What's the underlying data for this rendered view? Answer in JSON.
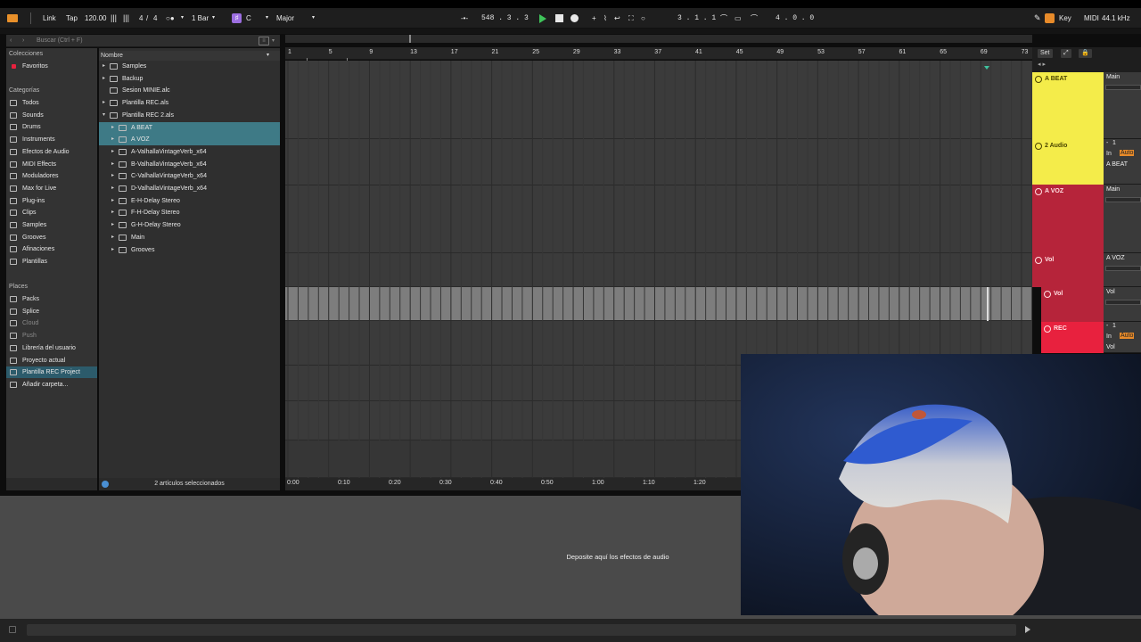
{
  "toolbar": {
    "link": "Link",
    "tap": "Tap",
    "tempo": "120.00",
    "time_sig_num": "4",
    "time_sig_sep": "/",
    "time_sig_den": "4",
    "quantize": "1 Bar",
    "scale_root": "C",
    "scale_mode": "Major",
    "position": "548 .  3 .  3",
    "punch_start": "3 .  1 .  1",
    "loop_length": "4 .  0 .  0",
    "key": "Key",
    "midi": "MIDI",
    "sample_rate": "44.1 kHz"
  },
  "browser": {
    "search_placeholder": "Buscar (Ctrl + F)",
    "collections_header": "Colecciones",
    "favorites": "Favoritos",
    "categories_header": "Categorías",
    "categories": [
      "Todos",
      "Sounds",
      "Drums",
      "Instruments",
      "Efectos de Audio",
      "MIDI Effects",
      "Moduladores",
      "Max for Live",
      "Plug-ins",
      "Clips",
      "Samples",
      "Grooves",
      "Afinaciones",
      "Plantillas"
    ],
    "places_header": "Places",
    "places": [
      "Packs",
      "Splice",
      "Cloud",
      "Push",
      "Librería del usuario",
      "Proyecto actual",
      "Plantilla REC Project",
      "Añadir carpeta..."
    ],
    "column_header": "Nombre",
    "files": [
      "Samples",
      "Backup",
      "Sesion MINIE.alc",
      "Plantilla REC.als",
      "Plantilla REC 2.als",
      "A BEAT",
      "A VOZ",
      "A-ValhallaVintageVerb_x64",
      "B-ValhallaVintageVerb_x64",
      "C-ValhallaVintageVerb_x64",
      "D-ValhallaVintageVerb_x64",
      "E-H-Delay Stereo",
      "F-H-Delay Stereo",
      "G-H-Delay Stereo",
      "Main",
      "Grooves"
    ],
    "status": "2 artículos seleccionados"
  },
  "arrangement": {
    "ruler_bars": [
      "1",
      "5",
      "9",
      "13",
      "17",
      "21",
      "25",
      "29",
      "33",
      "37",
      "41",
      "45",
      "49",
      "53",
      "57",
      "61",
      "65",
      "69",
      "73"
    ],
    "time_marks": [
      "0:00",
      "0:10",
      "0:20",
      "0:30",
      "0:40",
      "0:50",
      "1:00",
      "1:10",
      "1:20"
    ]
  },
  "header": {
    "set_button": "Set"
  },
  "tracks": [
    {
      "name": "A BEAT",
      "color": "#f4ec4a",
      "io_label": "Main"
    },
    {
      "name": "2 Audio",
      "color": "#f4ec4a",
      "io_in": "In",
      "io_auto": "Auto",
      "io_num": "1",
      "io_src": "A BEAT"
    },
    {
      "name": "A VOZ",
      "color": "#b6243a",
      "io_label": "Main"
    },
    {
      "name": "Vol",
      "color": "#b6243a",
      "io_label": "A VOZ"
    },
    {
      "name": "Vol",
      "color": "#b6243a",
      "io_label": "Vol"
    },
    {
      "name": "REC",
      "color": "#e8213e",
      "io_in": "In",
      "io_auto": "Auto",
      "io_num": "1",
      "io_src": "Vol"
    }
  ],
  "device_panel": {
    "hint": "Deposite aquí los efectos de audio"
  },
  "colors": {
    "accent_yellow": "#f4ec4a",
    "accent_red": "#b6243a",
    "rec_red": "#e8213e",
    "selection_teal": "#3e7a86",
    "auto_orange": "#e88b2a",
    "play_green": "#3fc45a"
  }
}
